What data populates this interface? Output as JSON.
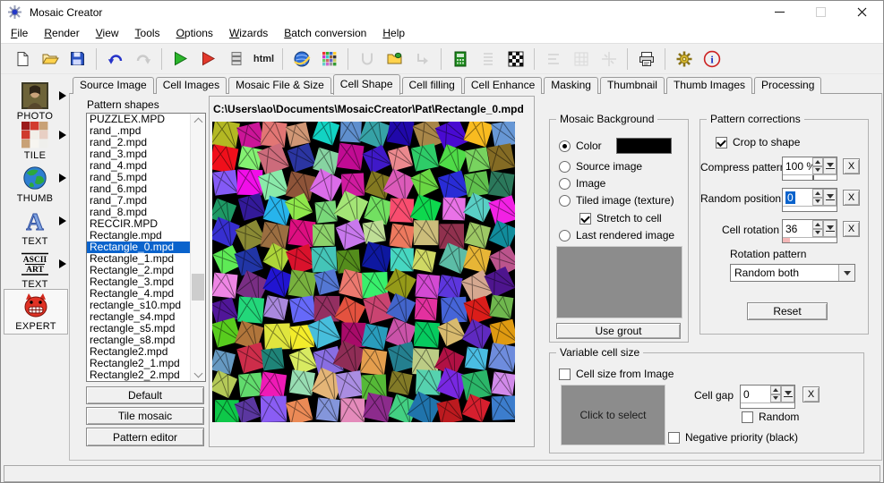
{
  "titlebar": {
    "title": "Mosaic Creator"
  },
  "menubar": {
    "items": [
      "File",
      "Render",
      "View",
      "Tools",
      "Options",
      "Wizards",
      "Batch conversion",
      "Help"
    ]
  },
  "toolbar": {
    "items": [
      {
        "name": "new-file"
      },
      {
        "name": "open-file"
      },
      {
        "name": "save-file"
      },
      {
        "sep": true
      },
      {
        "name": "undo"
      },
      {
        "name": "redo",
        "disabled": true
      },
      {
        "sep": true
      },
      {
        "name": "render-green"
      },
      {
        "name": "render-red"
      },
      {
        "name": "cell-stack"
      },
      {
        "name": "html-export",
        "text": "html"
      },
      {
        "sep": true
      },
      {
        "name": "web-globe"
      },
      {
        "name": "mosaic-grid"
      },
      {
        "sep": true
      },
      {
        "name": "shape-u",
        "disabled": true
      },
      {
        "name": "pattern-folder"
      },
      {
        "name": "import-arrow",
        "disabled": true
      },
      {
        "sep": true
      },
      {
        "name": "green-panel"
      },
      {
        "name": "row-list",
        "disabled": true
      },
      {
        "name": "checker-grid"
      },
      {
        "sep": true
      },
      {
        "name": "align-lines",
        "disabled": true
      },
      {
        "name": "grid-lines",
        "disabled": true
      },
      {
        "name": "crop-marks",
        "disabled": true
      },
      {
        "sep": true
      },
      {
        "name": "print"
      },
      {
        "sep": true
      },
      {
        "name": "settings-gear"
      },
      {
        "name": "info"
      }
    ]
  },
  "tabs": {
    "items": [
      "Source Image",
      "Cell Images",
      "Mosaic File & Size",
      "Cell Shape",
      "Cell filling",
      "Cell Enhance",
      "Masking",
      "Thumbnail",
      "Thumb Images",
      "Processing"
    ],
    "active": "Cell Shape"
  },
  "sidebar": {
    "items": [
      {
        "id": "photo",
        "label": "PHOTO",
        "arrow": true,
        "selected": false
      },
      {
        "id": "tile",
        "label": "TILE",
        "arrow": true,
        "selected": false
      },
      {
        "id": "thumb",
        "label": "THUMB",
        "arrow": true,
        "selected": false
      },
      {
        "id": "text",
        "label": "TEXT",
        "arrow": true,
        "selected": false
      },
      {
        "id": "ascii",
        "label": "TEXT",
        "arrow": true,
        "selected": false,
        "icon_lines": [
          "ASCII",
          "ART"
        ]
      },
      {
        "id": "expert",
        "label": "EXPERT",
        "arrow": false,
        "selected": true
      }
    ]
  },
  "pattern_panel": {
    "label": "Pattern shapes",
    "items": [
      "PUZZLEX.MPD",
      "rand_.mpd",
      "rand_2.mpd",
      "rand_3.mpd",
      "rand_4.mpd",
      "rand_5.mpd",
      "rand_6.mpd",
      "rand_7.mpd",
      "rand_8.mpd",
      "RECCIR.MPD",
      "Rectangle.mpd",
      "Rectangle_0.mpd",
      "Rectangle_1.mpd",
      "Rectangle_2.mpd",
      "Rectangle_3.mpd",
      "Rectangle_4.mpd",
      "rectangle_s10.mpd",
      "rectangle_s4.mpd",
      "rectangle_s5.mpd",
      "rectangle_s8.mpd",
      "Rectangle2.mpd",
      "Rectangle2_1.mpd",
      "Rectangle2_2.mpd"
    ],
    "selected": "Rectangle_0.mpd",
    "buttons": {
      "default": "Default",
      "tile_mosaic": "Tile mosaic",
      "pattern_editor": "Pattern editor"
    }
  },
  "preview": {
    "path": "C:\\Users\\ao\\Documents\\MosaicCreator\\Pat\\Rectangle_0.mpd",
    "mosaic": {
      "cols": 12,
      "rows": 12,
      "background": "#000000"
    }
  },
  "mosaic_background": {
    "title": "Mosaic Background",
    "options": [
      {
        "label": "Color",
        "selected": true
      },
      {
        "label": "Source image",
        "selected": false
      },
      {
        "label": "Image",
        "selected": false
      },
      {
        "label": "Tiled image (texture)",
        "selected": false
      },
      {
        "label": "Last rendered image",
        "selected": false
      }
    ],
    "color_swatch": "#000000",
    "stretch_to_cell": {
      "label": "Stretch to cell",
      "checked": true
    },
    "use_grout": "Use grout"
  },
  "pattern_corrections": {
    "title": "Pattern corrections",
    "crop_to_shape": {
      "label": "Crop to shape",
      "checked": true
    },
    "compress_pattern": {
      "label": "Compress pattern",
      "value": "100 %"
    },
    "random_position": {
      "label": "Random position",
      "value": "0"
    },
    "cell_rotation": {
      "label": "Cell rotation",
      "value": "36"
    },
    "rotation_pattern": {
      "label": "Rotation pattern",
      "value": "Random both"
    },
    "reset": "Reset",
    "clear_button": "X"
  },
  "variable_cell_size": {
    "title": "Variable cell size",
    "cell_size_from_image": {
      "label": "Cell size from Image",
      "checked": false
    },
    "click_to_select": "Click to select",
    "cell_gap": {
      "label": "Cell gap",
      "value": "0"
    },
    "random": {
      "label": "Random",
      "checked": false
    },
    "negative_priority": {
      "label": "Negative priority (black)",
      "checked": false
    },
    "clear_button": "X"
  }
}
